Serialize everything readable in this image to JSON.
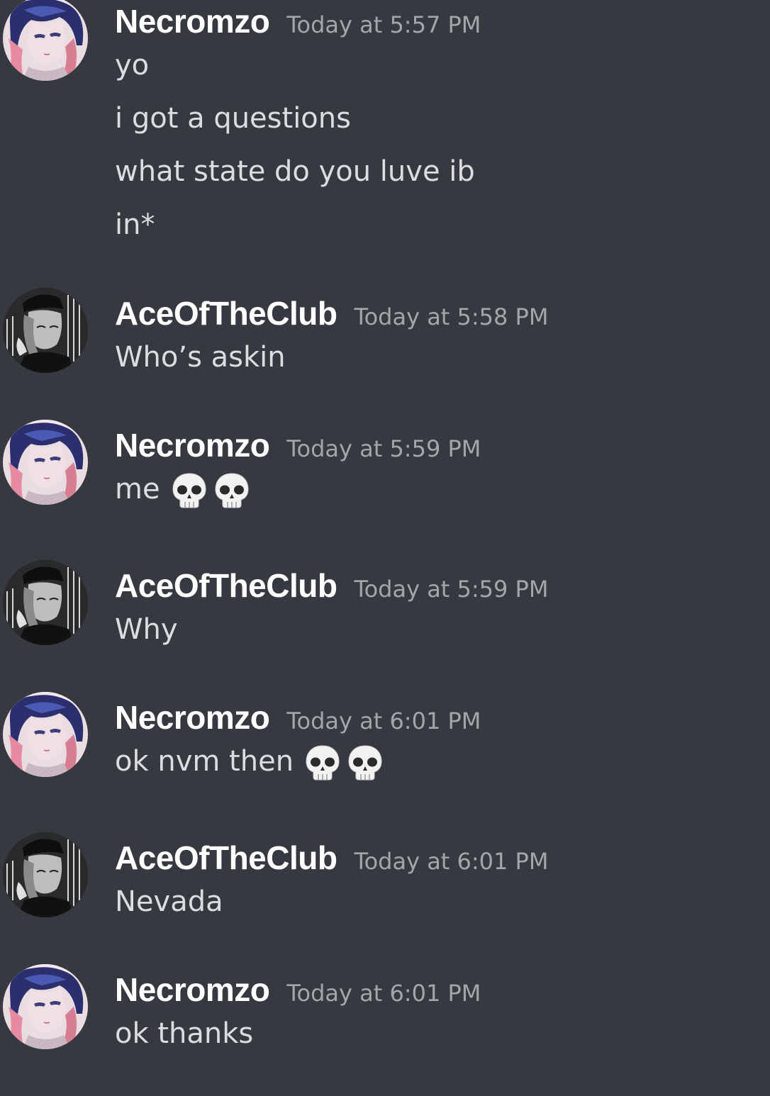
{
  "messages": [
    {
      "author": "Necromzo",
      "avatar": "necromzo-avatar",
      "timestamp": "Today at 5:57 PM",
      "lines": [
        "yo",
        "i got a questions",
        "what state do you luve ib",
        "in*"
      ]
    },
    {
      "author": "AceOfTheClub",
      "avatar": "aceoftheclub-avatar",
      "timestamp": "Today at 5:58 PM",
      "lines": [
        "Who’s askin"
      ]
    },
    {
      "author": "Necromzo",
      "avatar": "necromzo-avatar",
      "timestamp": "Today at 5:59 PM",
      "lines": [
        "me"
      ],
      "emoji": [
        "skull-emoji",
        "skull-emoji"
      ]
    },
    {
      "author": "AceOfTheClub",
      "avatar": "aceoftheclub-avatar",
      "timestamp": "Today at 5:59 PM",
      "lines": [
        "Why"
      ]
    },
    {
      "author": "Necromzo",
      "avatar": "necromzo-avatar",
      "timestamp": "Today at 6:01 PM",
      "lines": [
        "ok nvm then"
      ],
      "emoji": [
        "skull-emoji",
        "skull-emoji"
      ]
    },
    {
      "author": "AceOfTheClub",
      "avatar": "aceoftheclub-avatar",
      "timestamp": "Today at 6:01 PM",
      "lines": [
        "Nevada"
      ]
    },
    {
      "author": "Necromzo",
      "avatar": "necromzo-avatar",
      "timestamp": "Today at 6:01 PM",
      "lines": [
        "ok thanks"
      ]
    }
  ],
  "colors": {
    "background": "#36393f",
    "username": "#ffffff",
    "timestamp": "#a3a6aa",
    "message_text": "#dcddde"
  }
}
